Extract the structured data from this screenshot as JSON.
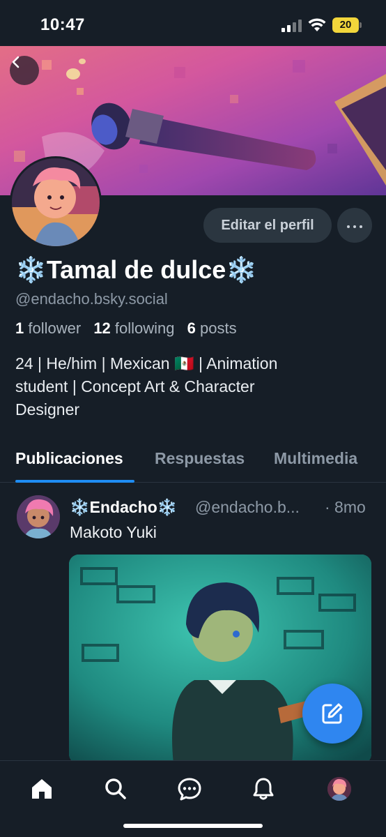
{
  "status_bar": {
    "time": "10:47",
    "battery": "20"
  },
  "profile": {
    "display_name": "❄️Tamal de dulce❄️",
    "handle": "@endacho.bsky.social",
    "followers_count": "1",
    "followers_label": "follower",
    "following_count": "12",
    "following_label": "following",
    "posts_count": "6",
    "posts_label": "posts",
    "bio_line1": "24 | He/him | Mexican 🇲🇽 | Animation",
    "bio_line2": "student | Concept Art & Character",
    "bio_line3": "Designer",
    "edit_label": "Editar el perfil"
  },
  "tabs": [
    {
      "label": "Publicaciones",
      "active": true
    },
    {
      "label": "Respuestas",
      "active": false
    },
    {
      "label": "Multimedia",
      "active": false
    }
  ],
  "post": {
    "author": "❄️Endacho❄️",
    "handle": "@endacho.b...",
    "time": "· 8mo",
    "text": "Makoto Yuki"
  },
  "colors": {
    "accent": "#1f8cf2",
    "fab": "#2f86f0",
    "background": "#161e27"
  },
  "icons": {
    "back": "chevron-left-icon",
    "more": "ellipsis-icon",
    "compose": "compose-icon",
    "home": "home-icon",
    "search": "search-icon",
    "chat": "chat-icon",
    "notifications": "bell-icon"
  }
}
